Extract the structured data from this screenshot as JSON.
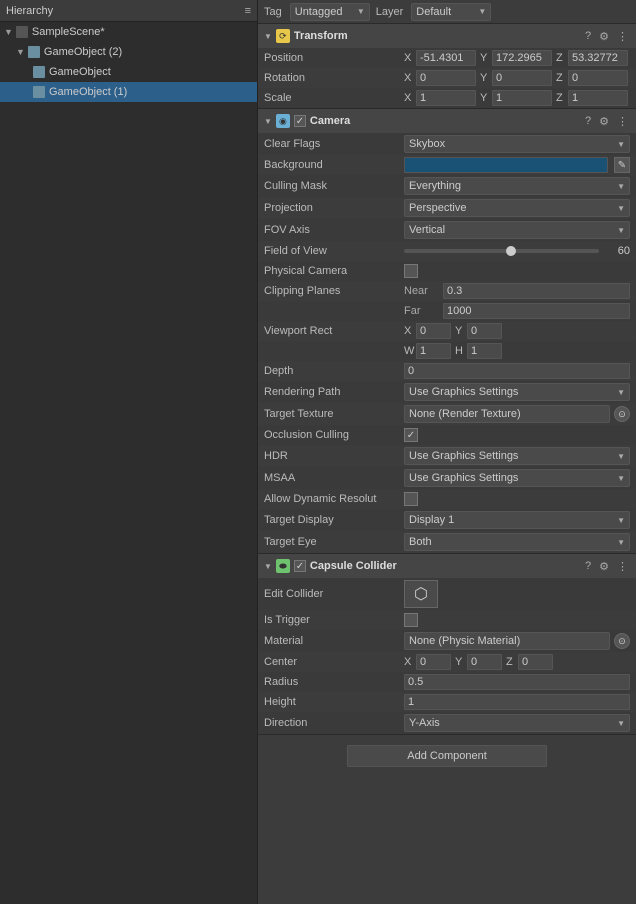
{
  "hierarchy": {
    "title": "Hierarchy",
    "items": [
      {
        "label": "SampleScene*",
        "indent": 0,
        "type": "scene",
        "selected": false
      },
      {
        "label": "GameObject (2)",
        "indent": 1,
        "type": "go",
        "selected": false
      },
      {
        "label": "GameObject",
        "indent": 2,
        "type": "go",
        "selected": false
      },
      {
        "label": "GameObject (1)",
        "indent": 2,
        "type": "go",
        "selected": true
      }
    ]
  },
  "inspector": {
    "tag": "Untagged",
    "layer": "Default",
    "transform": {
      "title": "Transform",
      "position": {
        "x": "-51.4301",
        "y": "172.2965",
        "z": "53.32772"
      },
      "rotation": {
        "x": "0",
        "y": "0",
        "z": "0"
      },
      "scale": {
        "x": "1",
        "y": "1",
        "z": "1"
      }
    },
    "camera": {
      "title": "Camera",
      "enabled": true,
      "clearFlags": "Skybox",
      "cullingMask": "Everything",
      "projection": "Perspective",
      "fovAxis": "Vertical",
      "fieldOfView": 60,
      "fieldOfViewSliderPos": "55%",
      "physicalCamera": false,
      "clippingNear": "0.3",
      "clippingFar": "1000",
      "viewportX": "0",
      "viewportY": "0",
      "viewportW": "1",
      "viewportH": "1",
      "depth": "0",
      "renderingPath": "Use Graphics Settings",
      "targetTexture": "None (Render Texture)",
      "occlusionCulling": true,
      "hdr": "Use Graphics Settings",
      "msaa": "Use Graphics Settings",
      "allowDynamicResolution": false,
      "targetDisplay": "Display 1",
      "targetEye": "Both"
    },
    "capsuleCollider": {
      "title": "Capsule Collider",
      "enabled": true,
      "isTrigger": false,
      "material": "None (Physic Material)",
      "centerX": "0",
      "centerY": "0",
      "centerZ": "0",
      "radius": "0.5",
      "height": "1",
      "direction": "Y-Axis"
    },
    "addComponent": "Add Component"
  },
  "labels": {
    "tag": "Tag",
    "layer": "Layer",
    "position": "Position",
    "rotation": "Rotation",
    "scale": "Scale",
    "clearFlags": "Clear Flags",
    "background": "Background",
    "cullingMask": "Culling Mask",
    "projection": "Projection",
    "fovAxis": "FOV Axis",
    "fieldOfView": "Field of View",
    "physicalCamera": "Physical Camera",
    "clippingPlanes": "Clipping Planes",
    "near": "Near",
    "far": "Far",
    "viewportRect": "Viewport Rect",
    "depth": "Depth",
    "renderingPath": "Rendering Path",
    "targetTexture": "Target Texture",
    "occlusionCulling": "Occlusion Culling",
    "hdr": "HDR",
    "msaa": "MSAA",
    "allowDynamic": "Allow Dynamic Resolut",
    "targetDisplay": "Target Display",
    "targetEye": "Target Eye",
    "editCollider": "Edit Collider",
    "isTrigger": "Is Trigger",
    "material": "Material",
    "center": "Center",
    "radius": "Radius",
    "height": "Height",
    "direction": "Direction"
  }
}
